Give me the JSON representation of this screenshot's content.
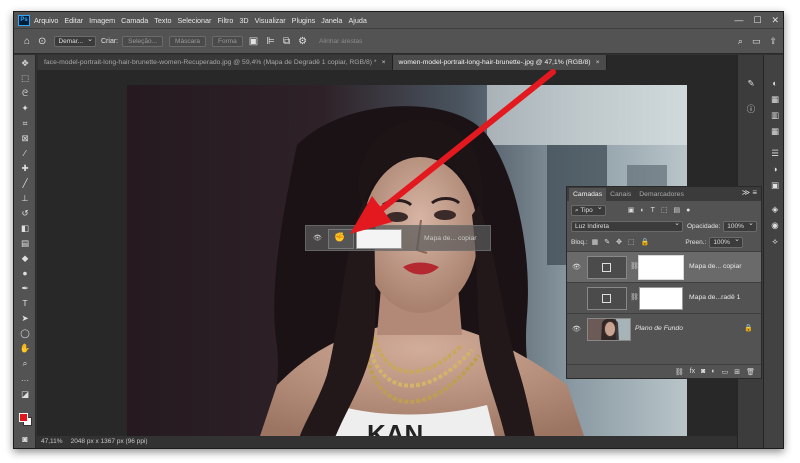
{
  "menubar": {
    "logo": "Ps",
    "items": [
      "Arquivo",
      "Editar",
      "Imagem",
      "Camada",
      "Texto",
      "Selecionar",
      "Filtro",
      "3D",
      "Visualizar",
      "Plugins",
      "Janela",
      "Ajuda"
    ],
    "window_controls": [
      "—",
      "☐",
      "✕"
    ]
  },
  "options": {
    "mode_value": "Demar...",
    "criar_label": "Criar:",
    "selecao_label": "Seleção...",
    "mascara_label": "Máscara",
    "forma_label": "Forma",
    "align_edges_label": "Alinhar arestas"
  },
  "tabs": [
    {
      "label": "face-model-portrait-long-hair-brunette-women-Recuperado.jpg @ 59,4% (Mapa de Degradê 1 copiar, RGB/8) *",
      "close": "×"
    },
    {
      "label": "women-model-portrait-long-hair-brunette-.jpg @ 47,1% (RGB/8)",
      "close": "×"
    }
  ],
  "ghost_layer": {
    "name": "Mapa de... copiar"
  },
  "layers_panel": {
    "tabs": [
      "Camadas",
      "Canais",
      "Demarcadores"
    ],
    "filter_value": "Tipo",
    "blend_mode": "Luz Indireta",
    "opacity_label": "Opacidade:",
    "opacity_value": "100%",
    "lock_label": "Bloq.:",
    "fill_label": "Preen.:",
    "fill_value": "100%",
    "layers": [
      {
        "name": "Mapa de... copiar",
        "selected": true,
        "visible": true
      },
      {
        "name": "Mapa de...radê 1",
        "selected": false,
        "visible": false
      },
      {
        "name": "Plano de Fundo",
        "selected": false,
        "visible": true
      }
    ]
  },
  "status": {
    "zoom": "47,11%",
    "doc_info": "2048 px x 1367 px (96 ppi)"
  },
  "colors": {
    "foreground": "#e5141c",
    "background": "#ffffff",
    "arrow": "#e3191f"
  }
}
